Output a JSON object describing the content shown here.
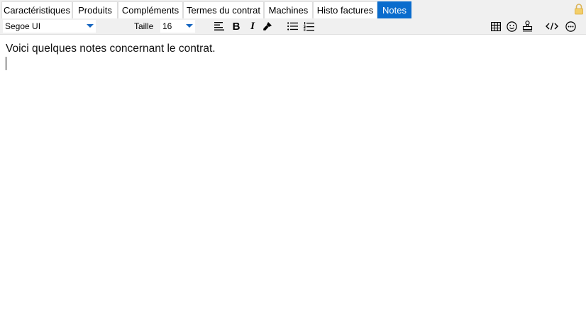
{
  "tabs": [
    {
      "label": "Caractéristiques",
      "active": false
    },
    {
      "label": "Produits",
      "active": false
    },
    {
      "label": "Compléments",
      "active": false
    },
    {
      "label": "Termes du contrat",
      "active": false
    },
    {
      "label": "Machines",
      "active": false
    },
    {
      "label": "Histo factures",
      "active": false
    },
    {
      "label": "Notes",
      "active": true
    }
  ],
  "toolbar": {
    "font_value": "Segoe UI",
    "size_label": "Taille",
    "size_value": "16",
    "bold_glyph": "B",
    "italic_glyph": "I"
  },
  "editor": {
    "text": "Voici quelques notes concernant le contrat."
  },
  "colors": {
    "accent": "#0a6ccd",
    "tabbar_bg": "#f0f0f0",
    "lock": "#f0c040"
  },
  "icons": [
    "lock-icon",
    "align-left-icon",
    "bold-icon",
    "italic-icon",
    "format-painter-icon",
    "bullet-list-icon",
    "numbered-list-icon",
    "table-icon",
    "emoji-icon",
    "stamp-icon",
    "code-icon",
    "more-icon"
  ]
}
